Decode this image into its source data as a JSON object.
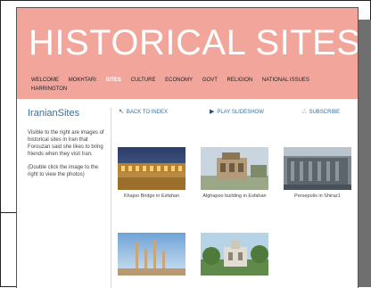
{
  "header": {
    "title": "HISTORICAL SITES"
  },
  "nav": {
    "items": [
      "WELCOME",
      "MOKHTARI",
      "SITES",
      "CULTURE",
      "ECONOMY",
      "GOVT",
      "RELIGION",
      "NATIONAL ISSUES",
      "HARRINGTON"
    ],
    "active": "SITES"
  },
  "sidebar": {
    "title": "IranianSites",
    "text1": "Visible to the right are images of historical sites in Iran that Forouzan said she likes to bring friends when they visit Iran.",
    "text2": "(Double click the image to the right to view the photos)"
  },
  "toolbar": {
    "back": "BACK TO INDEX",
    "slideshow": "PLAY SLIDESHOW",
    "subscribe": "SUBSCRIBE"
  },
  "gallery": [
    {
      "caption": "Khajoo Bridge in Esfahan"
    },
    {
      "caption": "Alghapoo building in Esfahan"
    },
    {
      "caption": "Persepolis in Shiraz1"
    },
    {
      "caption": ""
    },
    {
      "caption": ""
    }
  ],
  "colors": {
    "header_bg": "#f2a59b",
    "accent": "#3a6f9a"
  }
}
